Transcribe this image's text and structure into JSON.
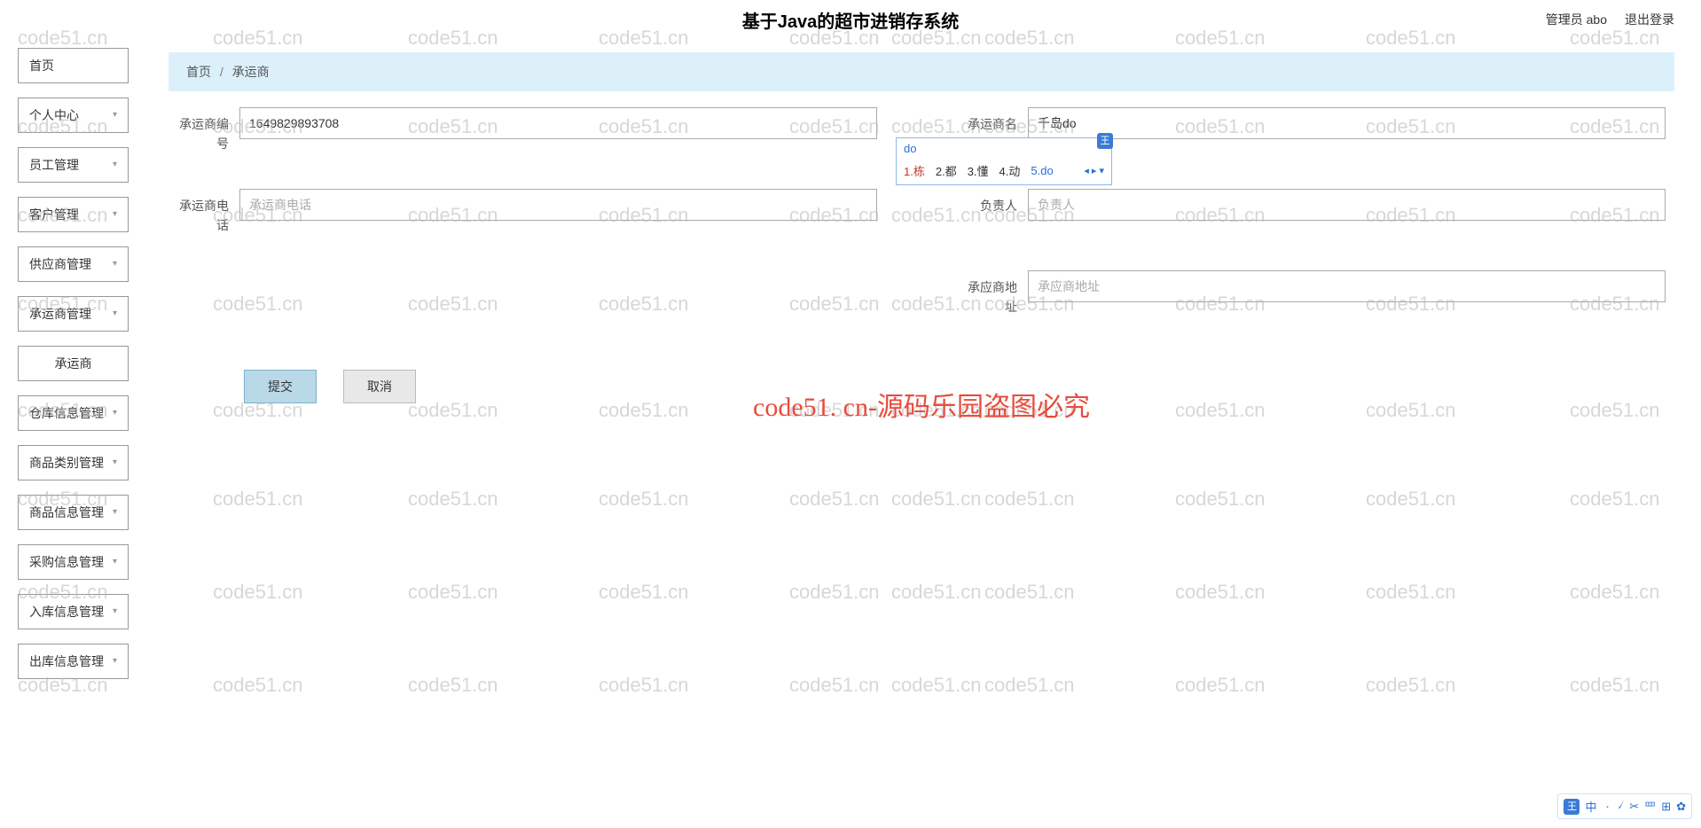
{
  "header": {
    "title": "基于Java的超市进销存系统",
    "user_label": "管理员 abo",
    "logout": "退出登录"
  },
  "sidebar": {
    "items": [
      {
        "label": "首页",
        "expandable": false
      },
      {
        "label": "个人中心",
        "expandable": true
      },
      {
        "label": "员工管理",
        "expandable": true
      },
      {
        "label": "客户管理",
        "expandable": true
      },
      {
        "label": "供应商管理",
        "expandable": true
      },
      {
        "label": "承运商管理",
        "expandable": true,
        "children": [
          {
            "label": "承运商"
          }
        ]
      },
      {
        "label": "仓库信息管理",
        "expandable": true
      },
      {
        "label": "商品类别管理",
        "expandable": true
      },
      {
        "label": "商品信息管理",
        "expandable": true
      },
      {
        "label": "采购信息管理",
        "expandable": true
      },
      {
        "label": "入库信息管理",
        "expandable": true
      },
      {
        "label": "出库信息管理",
        "expandable": true
      }
    ]
  },
  "breadcrumb": {
    "home": "首页",
    "separator": "/",
    "current": "承运商"
  },
  "form": {
    "carrier_no": {
      "label": "承运商编号",
      "value": "1649829893708",
      "placeholder": ""
    },
    "carrier_name": {
      "label": "承运商名称",
      "value": "千岛do",
      "placeholder": ""
    },
    "carrier_phone": {
      "label": "承运商电话",
      "value": "",
      "placeholder": "承运商电话"
    },
    "principal": {
      "label": "负责人",
      "value": "",
      "placeholder": "负责人"
    },
    "carrier_addr": {
      "label": "承应商地址",
      "value": "",
      "placeholder": "承应商地址"
    }
  },
  "buttons": {
    "submit": "提交",
    "cancel": "取消"
  },
  "ime": {
    "badge": "王",
    "input": "do",
    "candidates": [
      {
        "n": "1",
        "t": "栋"
      },
      {
        "n": "2",
        "t": "都"
      },
      {
        "n": "3",
        "t": "懂"
      },
      {
        "n": "4",
        "t": "动"
      },
      {
        "n": "5",
        "t": "do"
      }
    ],
    "arrows": "◂ ▸ ▾"
  },
  "watermark": "code51. cn-源码乐园盗图必究",
  "wm_tile": "code51.cn",
  "toolbar": {
    "badge": "王",
    "items": [
      "中",
      "ㆍ",
      "৴",
      "✂",
      "罒",
      "⊞",
      "✿"
    ]
  }
}
